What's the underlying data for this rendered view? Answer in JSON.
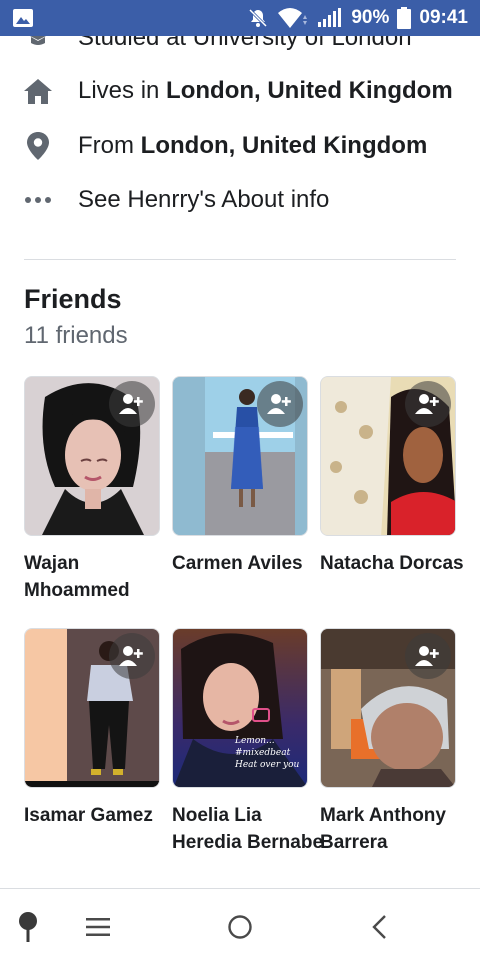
{
  "status_bar": {
    "battery": "90%",
    "time": "09:41",
    "icons": [
      "image-icon",
      "bell-off-icon",
      "wifi-icon",
      "signal-icon",
      "battery-icon"
    ]
  },
  "about": {
    "studied": {
      "text": "Studied at University of London",
      "icon": "education-icon"
    },
    "lives": {
      "prefix": "Lives in ",
      "place": "London, United Kingdom",
      "icon": "home-icon"
    },
    "from": {
      "prefix": "From ",
      "place": "London, United Kingdom",
      "icon": "location-pin-icon"
    },
    "see_more": {
      "text": "See Henrry's About info",
      "icon": "more-dots-icon"
    }
  },
  "friends": {
    "title": "Friends",
    "count": "11 friends",
    "items": [
      {
        "name": "Wajan Mhoammed"
      },
      {
        "name": "Carmen Aviles"
      },
      {
        "name": "Natacha Dorcas"
      },
      {
        "name": "Isamar Gamez"
      },
      {
        "name": "Noelia Lia Heredia Bernabe"
      },
      {
        "name": "Mark Anthony Barrera"
      }
    ],
    "photo_caption": "Lemon... #mixedbeat Heat over you"
  },
  "nav": {
    "icons": [
      "pin-icon",
      "menu-icon",
      "home-circle-icon",
      "back-icon"
    ]
  },
  "colors": {
    "status_bar": "#3b5ea8",
    "text_primary": "#1c1e21",
    "text_secondary": "#606770",
    "divider": "#dadde1"
  }
}
